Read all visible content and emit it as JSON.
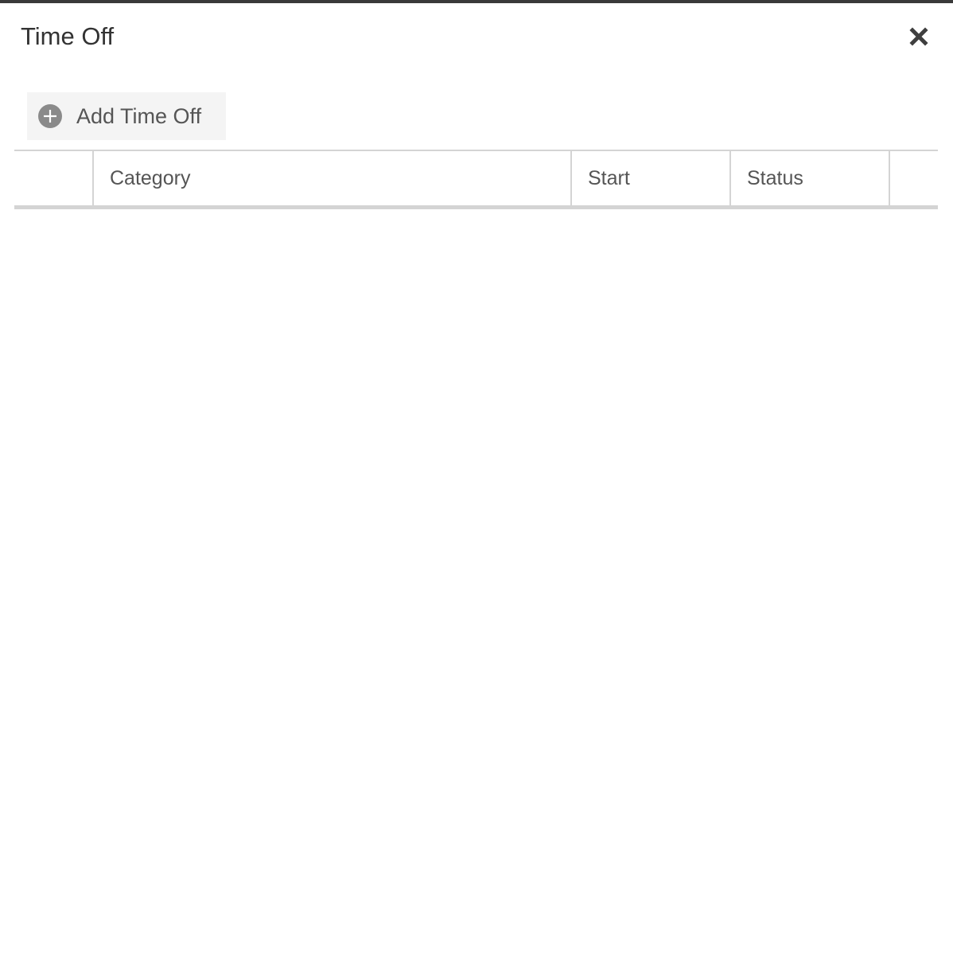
{
  "dialog": {
    "title": "Time Off",
    "close_icon": "close-x-icon"
  },
  "toolbar": {
    "add_button_label": "Add Time Off",
    "add_icon": "plus-circle-icon"
  },
  "grid": {
    "columns": [
      {
        "label": ""
      },
      {
        "label": "Category"
      },
      {
        "label": "Start"
      },
      {
        "label": "Status"
      },
      {
        "label": ""
      }
    ],
    "rows": []
  },
  "colors": {
    "title_text": "#333333",
    "header_text": "#555555",
    "border": "#d4d4d4",
    "button_bg": "#f4f4f4",
    "icon_gray": "#8a8a8a",
    "top_bar": "#3a3a3a"
  }
}
